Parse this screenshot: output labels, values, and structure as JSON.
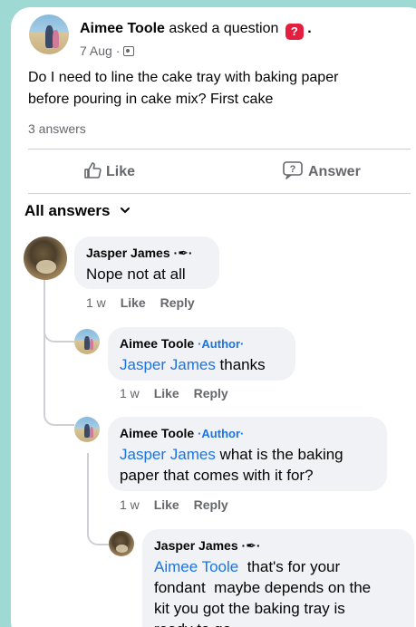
{
  "post": {
    "author": "Aimee Toole",
    "action": "asked a question",
    "date": "7 Aug",
    "separator": "·",
    "question_line1": "Do I need to line the cake tray with baking paper",
    "question_line2": "before pouring in cake mix? First cake",
    "answers_count": "3 answers"
  },
  "actions": {
    "like_label": "Like",
    "answer_label": "Answer"
  },
  "answers_header": {
    "label": "All answers"
  },
  "comments": [
    {
      "author": "Jasper James",
      "text": "Nope not at all",
      "time": "1 w",
      "like": "Like",
      "reply": "Reply"
    },
    {
      "author": "Aimee Toole",
      "badge": "·Author·",
      "mention": "Jasper James",
      "text": " thanks",
      "time": "1 w",
      "like": "Like",
      "reply": "Reply"
    },
    {
      "author": "Aimee Toole",
      "badge": "·Author·",
      "mention": "Jasper James",
      "text_line1": " what is the baking",
      "text_line2": "paper that comes with it for?",
      "time": "1 w",
      "like": "Like",
      "reply": "Reply"
    },
    {
      "author": "Jasper James",
      "mention": "Aimee Toole",
      "text_line1": "  that's for your",
      "text_line2": "fondant  maybe depends on the",
      "text_line3": "kit you got the baking tray is",
      "text_line4": "ready to go"
    }
  ],
  "colors": {
    "background": "#9fd9d3",
    "link": "#1b74e4",
    "question_badge": "#e41e3f",
    "bubble": "#f0f2f5"
  },
  "icons": {
    "question_badge": "question-mark-icon",
    "privacy": "group-privacy-icon",
    "like": "thumbs-up-icon",
    "answer": "question-bubble-icon",
    "dropdown": "chevron-down-icon",
    "contributor": "pen-nib-icon"
  }
}
